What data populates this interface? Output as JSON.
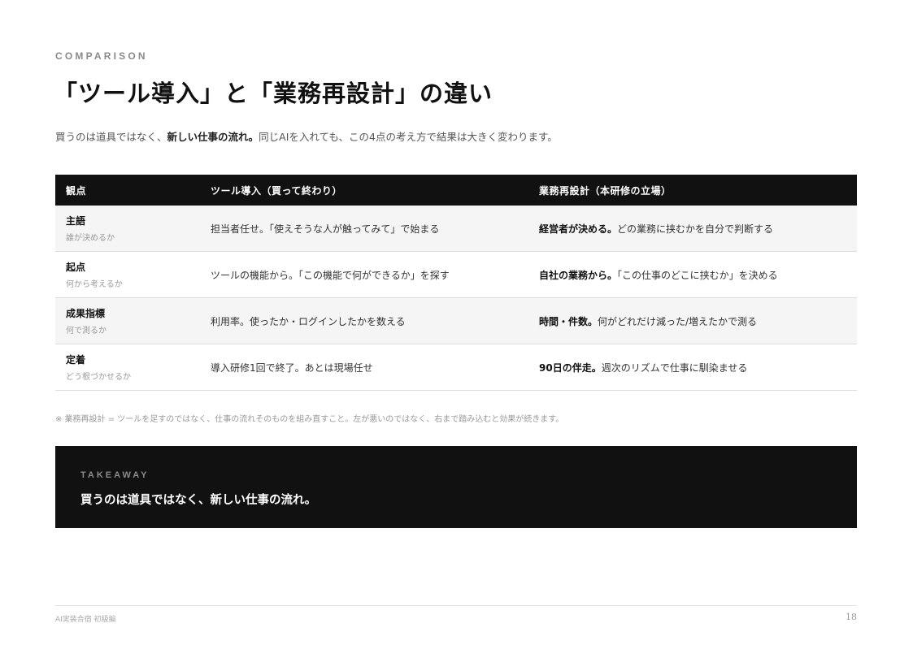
{
  "header": {
    "eyebrow": "COMPARISON",
    "title": "「ツール導入」と「業務再設計」の違い",
    "lead_prefix": "買うのは道具ではなく、",
    "lead_bold": "新しい仕事の流れ。",
    "lead_suffix": "同じAIを入れても、この4点の考え方で結果は大きく変わります。"
  },
  "table": {
    "columns": [
      "観点",
      "ツール導入（買って終わり）",
      "業務再設計（本研修の立場）"
    ],
    "rows": [
      {
        "aspect": "主語",
        "aspect_sub": "誰が決めるか",
        "tool": "担当者任せ。「使えそうな人が触ってみて」で始まる",
        "redesign_bold": "経営者が決める。",
        "redesign_text": "どの業務に挟むかを自分で判断する"
      },
      {
        "aspect": "起点",
        "aspect_sub": "何から考えるか",
        "tool": "ツールの機能から。「この機能で何ができるか」を探す",
        "redesign_bold": "自社の業務から。",
        "redesign_text": "「この仕事のどこに挟むか」を決める"
      },
      {
        "aspect": "成果指標",
        "aspect_sub": "何で測るか",
        "tool": "利用率。使ったか・ログインしたかを数える",
        "redesign_bold": "時間・件数。",
        "redesign_text": "何がどれだけ減った/増えたかで測る"
      },
      {
        "aspect": "定着",
        "aspect_sub": "どう根づかせるか",
        "tool": "導入研修1回で終了。あとは現場任せ",
        "redesign_bold": "90日の伴走。",
        "redesign_text": "週次のリズムで仕事に馴染ませる"
      }
    ]
  },
  "note": "※ 業務再設計 = ツールを足すのではなく、仕事の流れそのものを組み直すこと。左が悪いのではなく、右まで踏み込むと効果が続きます。",
  "takeaway": {
    "label": "TAKEAWAY",
    "text": "買うのは道具ではなく、新しい仕事の流れ。"
  },
  "footer": {
    "left": "AI実装合宿 初級編",
    "page": "18"
  }
}
